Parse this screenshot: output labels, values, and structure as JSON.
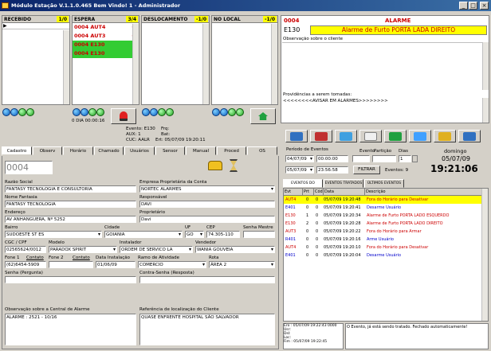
{
  "window": {
    "title": "Módulo Estação V.1.1.0.465    Bem Vindo! 1 - Administrador"
  },
  "queues": {
    "recebido": {
      "label": "RECEBIDO",
      "count": "1/0"
    },
    "espera": {
      "label": "ESPERA",
      "count": "3/4",
      "rows": [
        {
          "code": "0004",
          "unit": "AUT4",
          "n": "0"
        },
        {
          "code": "0004",
          "unit": "AUT3",
          "n": "0"
        },
        {
          "code": "0004",
          "unit": "E130",
          "n": "1"
        },
        {
          "code": "0004",
          "unit": "E130",
          "n": "2"
        }
      ]
    },
    "deslocamento": {
      "label": "DESLOCAMENTO",
      "count": "-1/0"
    },
    "nolocal": {
      "label": "NO LOCAL",
      "count": "-1/0"
    }
  },
  "alarm": {
    "code": "0004",
    "title": "ALARME",
    "zone": "E130",
    "description": "Alarme de Furto PORTA LADA DIREITO",
    "obs_label": "Observação sobre o cliente",
    "proc_label": "Providências a serem tomadas:",
    "proc_text": "<<<<<<<<AVISAR EM ALARMES>>>>>>>>"
  },
  "status_strip": {
    "dia": "0 DIA 00:00:16",
    "ev_label": "Evento: E130",
    "aux": "AUX: 1",
    "cuc": "CUC: AALR",
    "freq": "Frq:",
    "bat": "Bat:",
    "ert": "Ert: 05/07/09 19:20:11"
  },
  "tabs": [
    "Cadastro",
    "Observ",
    "Horário",
    "Chamado",
    "Usuários",
    "Sensor",
    "Manual",
    "Proced",
    "OS"
  ],
  "cadastro": {
    "code": "0004",
    "razao_label": "Razão Social",
    "razao": "FANTASY TECNOLOGIA E CONSULTORIA",
    "empresa_label": "Empresa Proprietária da Conta",
    "empresa": "NORTEC ALARMES",
    "fantasia_label": "Nome Fantasia",
    "fantasia": "FANTASY TECNOLOGIA",
    "responsavel_label": "Responsável",
    "responsavel": "DAVI",
    "endereco_label": "Endereço",
    "endereco": "AV ANHANGUERA, Nº 5252",
    "proprietario_label": "Proprietário",
    "proprietario": "Davi",
    "bairro_label": "Bairro",
    "bairro": "SUDOESTE ST ES",
    "cidade_label": "Cidade",
    "cidade": "GOIANIA",
    "uf_label": "UF",
    "uf": "GO",
    "cep_label": "CEP",
    "cep": "74.305-110",
    "senha_mestre_label": "Senha Mestre",
    "cgc_label": "CGC / CPF",
    "cgc": "02565624/0012",
    "modelo_label": "Modelo",
    "modelo": "PARADOX SPIRIT",
    "instalador_label": "Instalador",
    "instalador": "ORDEM DE SERVICO LA",
    "vendedor_label": "Vendedor",
    "vendedor": "WANIA GOUVEIA",
    "fone1_label": "Fone 1",
    "fone1": "(62)6454-5909",
    "fone1_btn": "Contato",
    "fone2_label": "Fone 2",
    "fone2_btn": "Contato",
    "data_inst_label": "Data Instalação",
    "data_inst": "01/06/09",
    "ramo_label": "Ramo de Atividade",
    "ramo": "COMERCIO",
    "rota_label": "Rota",
    "rota": "ÁREA 2",
    "senha_pergunta_label": "Senha (Pergunta)",
    "contra_senha_label": "Contra-Senha (Resposta)",
    "obs_central_label": "Observação sobre a Central de Alarme",
    "obs_central": "ALARME : 2521 - 10/16",
    "ref_label": "Referência de localização do Cliente",
    "ref": "QUASE ENFRENTE HOSPITAL SÃO SALVADOR"
  },
  "filters": {
    "periodo_label": "Período de Eventos",
    "date1": "04/07/09",
    "time1": "00:00:00",
    "date2": "05/07/09",
    "time2": "23:56:58",
    "evento_label": "Evento",
    "particao_label": "Partição",
    "dias_label": "Dias",
    "dias": "1",
    "filtrar": "FILTRAR",
    "eventos": "Eventos: 9",
    "weekday": "domingo",
    "date": "05/07/09",
    "clock": "19:21:06"
  },
  "event_tabs": [
    "EVENTOS DO CLIENTE",
    "EVENTOS TRATADOS",
    "ÚLTIMOS EVENTOS"
  ],
  "event_columns": [
    "Evt",
    "Prt",
    "Cód",
    "Data",
    "Descrição"
  ],
  "events": [
    {
      "evt": "AUT4",
      "prt": "0",
      "cod": "0",
      "date": "05/07/09 19:20:48",
      "desc": "Fora do Horário para Desativar",
      "color": "#cc0000",
      "sel": true
    },
    {
      "evt": "E401",
      "prt": "0",
      "cod": "0",
      "date": "05/07/09 19:20:41",
      "desc": "Desarme Usuário",
      "color": "#0000cc",
      "sel": false
    },
    {
      "evt": "E130",
      "prt": "1",
      "cod": "0",
      "date": "05/07/09 19:20:34",
      "desc": "Alarme de Furto PORTA LADO ESQUERDO",
      "color": "#cc0000",
      "sel": false
    },
    {
      "evt": "E130",
      "prt": "2",
      "cod": "0",
      "date": "05/07/09 19:20:28",
      "desc": "Alarme de Furto PORTA LADO DIREITO",
      "color": "#cc0000",
      "sel": false
    },
    {
      "evt": "AUT3",
      "prt": "0",
      "cod": "0",
      "date": "05/07/09 19:20:22",
      "desc": "Fora do Horário para Armar",
      "color": "#cc0000",
      "sel": false
    },
    {
      "evt": "R401",
      "prt": "0",
      "cod": "0",
      "date": "05/07/09 19:20:16",
      "desc": "Arme Usuário",
      "color": "#0000cc",
      "sel": false
    },
    {
      "evt": "AUT4",
      "prt": "0",
      "cod": "0",
      "date": "05/07/09 19:20:10",
      "desc": "Fora do Horário para Desativar",
      "color": "#cc0000",
      "sel": false
    },
    {
      "evt": "E401",
      "prt": "0",
      "cod": "0",
      "date": "05/07/09 19:20:04",
      "desc": "Desarme Usuário",
      "color": "#0000cc",
      "sel": false
    }
  ],
  "footer": {
    "left1": "Ero : 05/07/09 19:22:43  0000",
    "left2": "Usr:",
    "left3": "Dsl:",
    "left4": "Loc:",
    "left5": "Fim : 05/07/09 19:22:45",
    "right": "O Evento, já está sendo tratado. Fechado automaticamente!"
  }
}
